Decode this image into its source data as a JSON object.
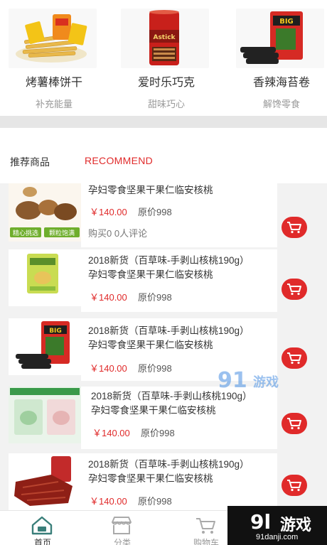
{
  "categories": [
    {
      "name": "烤薯棒饼干",
      "sub": "补充能量"
    },
    {
      "name": "爱时乐巧克",
      "sub": "甜味巧心"
    },
    {
      "name": "香辣海苔卷",
      "sub": "解馋零食"
    }
  ],
  "recommend": {
    "title_cn": "推荐商品",
    "title_en": "RECOMMEND"
  },
  "products": [
    {
      "title1": "",
      "title2": "孕妇零食坚果干果仁临安核桃",
      "price": "￥140.00",
      "original": "原价998",
      "buys": "购买0",
      "reviews": "0人评论",
      "badge1": "精心挑选",
      "badge2": "颗粒饱满"
    },
    {
      "title1": "2018新货（百草味-手剥山核桃190g）",
      "title2": "孕妇零食坚果干果仁临安核桃",
      "price": "￥140.00",
      "original": "原价998"
    },
    {
      "title1": "2018新货（百草味-手剥山核桃190g）",
      "title2": "孕妇零食坚果干果仁临安核桃",
      "price": "￥140.00",
      "original": "原价998"
    },
    {
      "title1": "2018新货（百草味-手剥山核桃190g）",
      "title2": "孕妇零食坚果干果仁临安核桃",
      "price": "￥140.00",
      "original": "原价998"
    },
    {
      "title1": "2018新货（百草味-手剥山核桃190g）",
      "title2": "孕妇零食坚果干果仁临安核桃",
      "price": "￥140.00",
      "original": "原价998"
    }
  ],
  "tabbar": [
    {
      "label": "首页",
      "icon": "home-icon"
    },
    {
      "label": "分类",
      "icon": "shop-icon"
    },
    {
      "label": "购物车",
      "icon": "cart-icon"
    }
  ],
  "watermark": {
    "mid_num": "91",
    "mid_text": "游戏",
    "corner_num": "9l",
    "corner_text": "游戏",
    "corner_url": "91danji.com"
  },
  "colors": {
    "accent": "#e02a2a",
    "watermark_blue": "#4a90e2"
  }
}
